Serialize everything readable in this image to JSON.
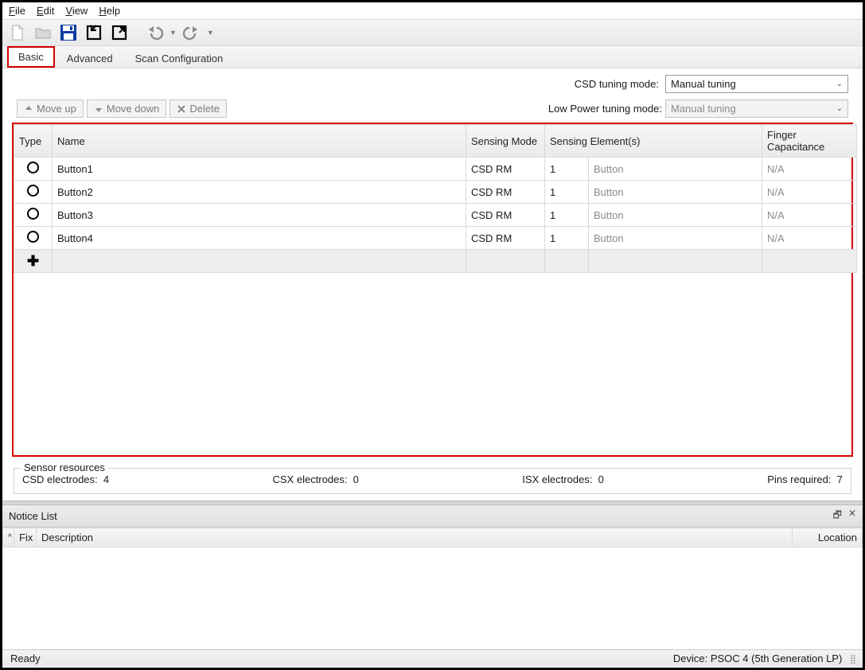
{
  "menu": {
    "file": "File",
    "edit": "Edit",
    "view": "View",
    "help": "Help"
  },
  "tabs": {
    "basic": "Basic",
    "advanced": "Advanced",
    "scan": "Scan Configuration"
  },
  "tuning": {
    "csd_label": "CSD tuning mode:",
    "csd_value": "Manual tuning",
    "lp_label": "Low Power tuning mode:",
    "lp_value": "Manual tuning"
  },
  "actions": {
    "moveup": "Move up",
    "movedown": "Move down",
    "delete": "Delete"
  },
  "table": {
    "headers": {
      "type": "Type",
      "name": "Name",
      "mode": "Sensing Mode",
      "elements": "Sensing Element(s)",
      "cap": "Finger Capacitance"
    },
    "rows": [
      {
        "name": "Button1",
        "mode": "CSD RM",
        "count": "1",
        "elem": "Button",
        "cap": "N/A"
      },
      {
        "name": "Button2",
        "mode": "CSD RM",
        "count": "1",
        "elem": "Button",
        "cap": "N/A"
      },
      {
        "name": "Button3",
        "mode": "CSD RM",
        "count": "1",
        "elem": "Button",
        "cap": "N/A"
      },
      {
        "name": "Button4",
        "mode": "CSD RM",
        "count": "1",
        "elem": "Button",
        "cap": "N/A"
      }
    ]
  },
  "sensor": {
    "legend": "Sensor resources",
    "csd_label": "CSD electrodes:",
    "csd_val": "4",
    "csx_label": "CSX electrodes:",
    "csx_val": "0",
    "isx_label": "ISX electrodes:",
    "isx_val": "0",
    "pins_label": "Pins required:",
    "pins_val": "7"
  },
  "notice": {
    "title": "Notice List",
    "fix": "Fix",
    "desc": "Description",
    "loc": "Location"
  },
  "status": {
    "left": "Ready",
    "right": "Device: PSOC 4 (5th Generation LP)"
  }
}
